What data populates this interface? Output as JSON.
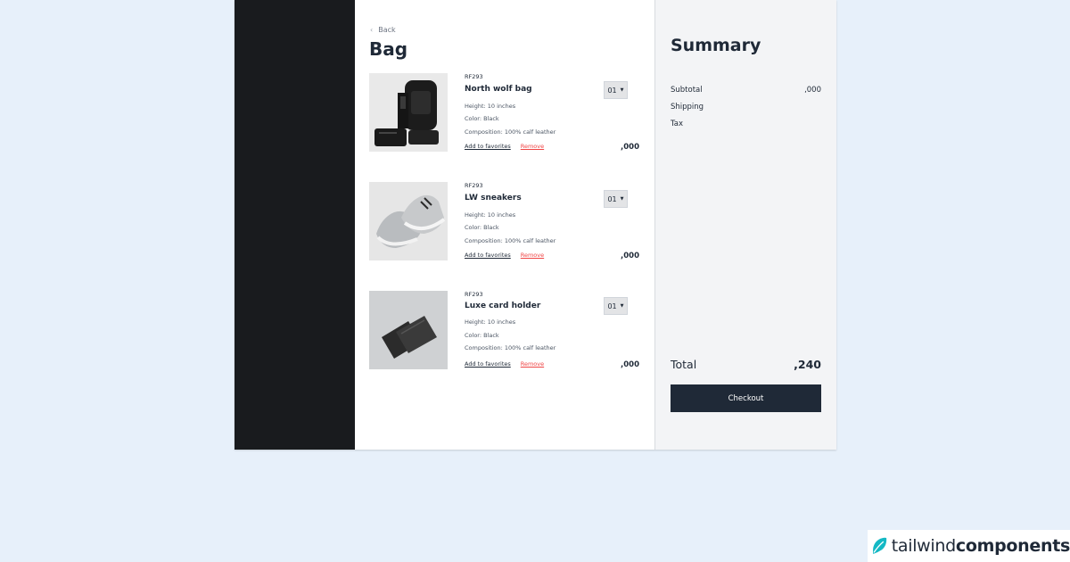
{
  "bag": {
    "back_label": "Back",
    "title": "Bag",
    "items": [
      {
        "sku": "RF293",
        "name": "North wolf bag",
        "height": "Height: 10 inches",
        "color": "Color: Black",
        "composition": "Composition: 100% calf leather",
        "favorite_label": "Add to favorites",
        "remove_label": "Remove",
        "quantity": "01",
        "price": ",000",
        "image_icon": "backpack-image"
      },
      {
        "sku": "RF293",
        "name": "LW sneakers",
        "height": "Height: 10 inches",
        "color": "Color: Black",
        "composition": "Composition: 100% calf leather",
        "favorite_label": "Add to favorites",
        "remove_label": "Remove",
        "quantity": "01",
        "price": ",000",
        "image_icon": "sneakers-image"
      },
      {
        "sku": "RF293",
        "name": "Luxe card holder",
        "height": "Height: 10 inches",
        "color": "Color: Black",
        "composition": "Composition: 100% calf leather",
        "favorite_label": "Add to favorites",
        "remove_label": "Remove",
        "quantity": "01",
        "price": ",000",
        "image_icon": "card-holder-image"
      }
    ]
  },
  "summary": {
    "title": "Summary",
    "subtotal_label": "Subtotal",
    "subtotal_value": ",000",
    "shipping_label": "Shipping",
    "tax_label": "Tax",
    "total_label": "Total",
    "total_value": ",240",
    "checkout_label": "Checkout"
  },
  "brand": {
    "light": "tailwind",
    "bold": "components",
    "logo_icon": "leaf-logo-icon",
    "accent": "#14b8c4"
  },
  "colors": {
    "background": "#e7f0fa",
    "dark_panel": "#191b1e",
    "checkout_button": "#1f2937",
    "remove_link": "#ef4444"
  }
}
